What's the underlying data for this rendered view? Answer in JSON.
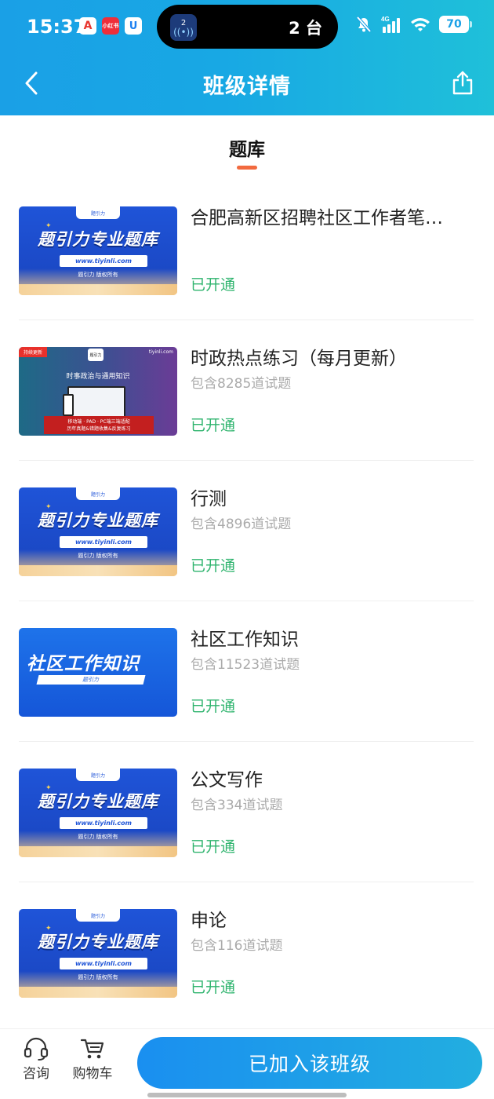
{
  "status_bar": {
    "time": "15:37",
    "island_text": "2 台",
    "island_badge": "2",
    "network": "4G",
    "battery": "70",
    "app_badges": [
      "A",
      "小红书",
      "U"
    ]
  },
  "nav": {
    "title": "班级详情"
  },
  "tab": {
    "label": "题库"
  },
  "covers": {
    "brand_title": "题引力专业题库",
    "brand_url": "www.tiyinli.com",
    "brand_rights": "题引力 版权所有",
    "brand_logo": "题引力",
    "politics_tag": "持续更新",
    "politics_site": "tiyinli.com",
    "politics_heading": "时事政治与通用知识",
    "politics_banner_1": "移动端 · PAD · PC端三端适配",
    "politics_banner_2": "历年真题&错题收集&反复练习",
    "community_title": "社区工作知识",
    "community_sub": "题引力"
  },
  "items": [
    {
      "title": "合肥高新区招聘社区工作者笔…",
      "count": "",
      "status": "已开通",
      "cover": "brand"
    },
    {
      "title": "时政热点练习（每月更新）",
      "count": "包含8285道试题",
      "status": "已开通",
      "cover": "politics"
    },
    {
      "title": "行测",
      "count": "包含4896道试题",
      "status": "已开通",
      "cover": "brand"
    },
    {
      "title": "社区工作知识",
      "count": "包含11523道试题",
      "status": "已开通",
      "cover": "community"
    },
    {
      "title": "公文写作",
      "count": "包含334道试题",
      "status": "已开通",
      "cover": "brand"
    },
    {
      "title": "申论",
      "count": "包含116道试题",
      "status": "已开通",
      "cover": "brand"
    }
  ],
  "bottom_bar": {
    "consult_label": "咨询",
    "cart_label": "购物车",
    "join_label": "已加入该班级"
  },
  "colors": {
    "header_gradient_start": "#1aa0e6",
    "header_gradient_end": "#1fc0d9",
    "tab_underline": "#f26a3f",
    "status_green": "#2fb46e",
    "button_gradient_start": "#1a8ff0",
    "button_gradient_end": "#22aee0"
  }
}
